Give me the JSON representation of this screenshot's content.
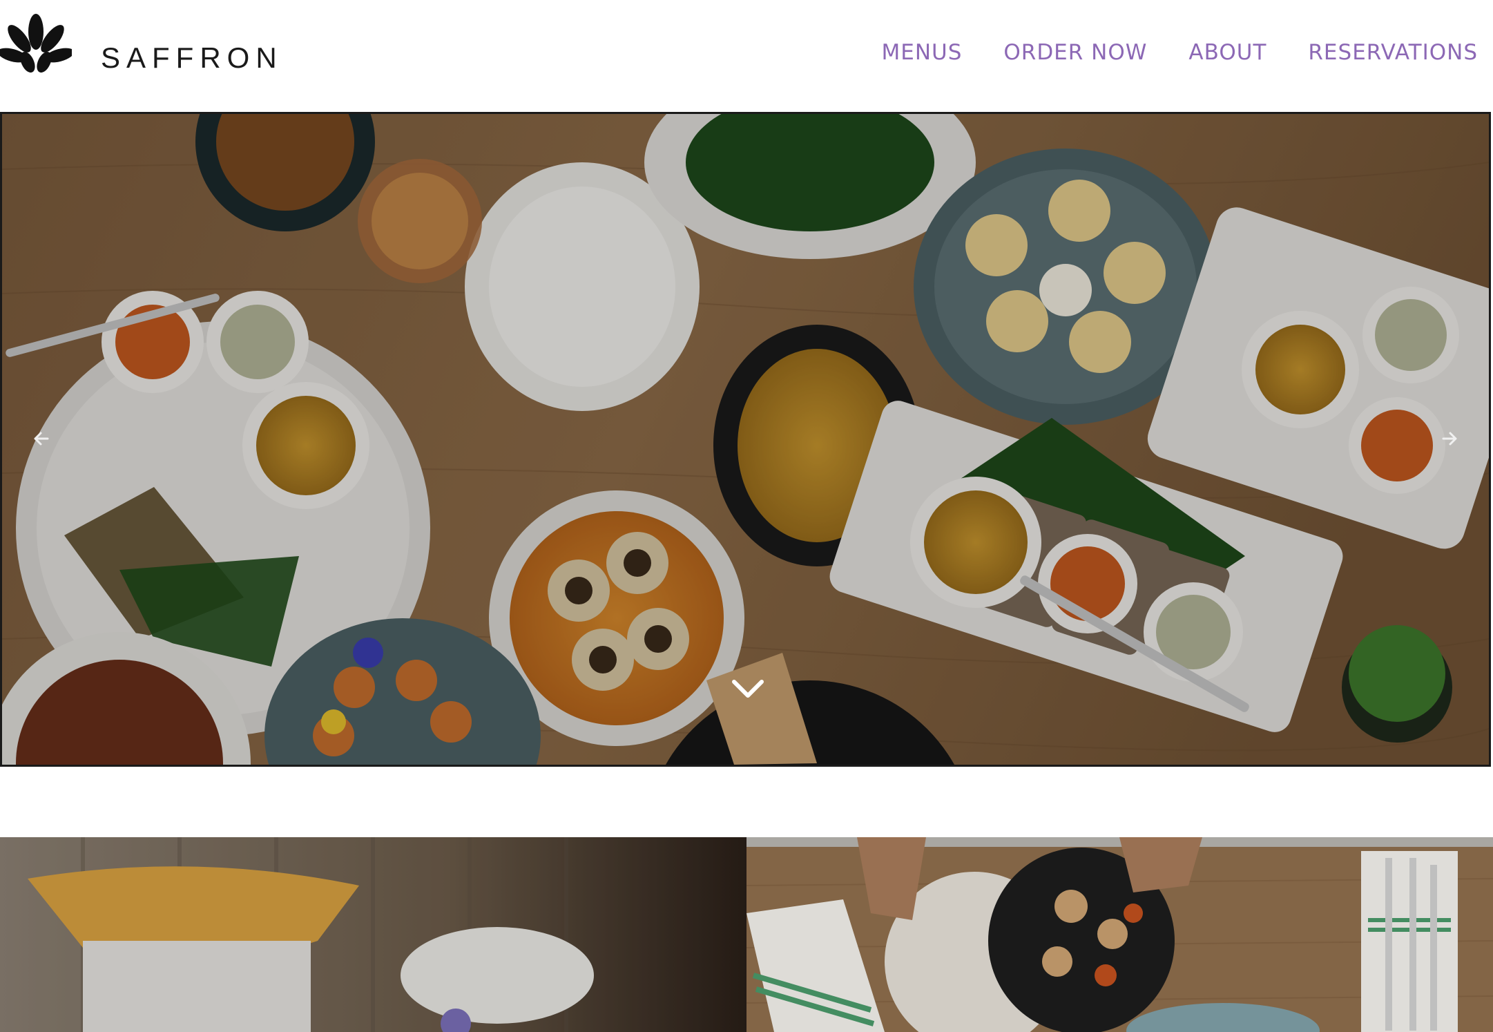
{
  "brand": {
    "name": "SAFFRON",
    "logo_icon": "lotus-flower-icon"
  },
  "nav": {
    "items": [
      {
        "label": "MENUS"
      },
      {
        "label": "ORDER NOW"
      },
      {
        "label": "ABOUT"
      },
      {
        "label": "RESERVATIONS"
      }
    ]
  },
  "hero": {
    "prev_icon": "arrow-left-icon",
    "next_icon": "arrow-right-icon",
    "scroll_icon": "chevron-down-icon"
  },
  "colors": {
    "nav_accent": "#8c68b5",
    "wordmark": "#1a1a1a",
    "table_wood": "#8a6a48"
  }
}
